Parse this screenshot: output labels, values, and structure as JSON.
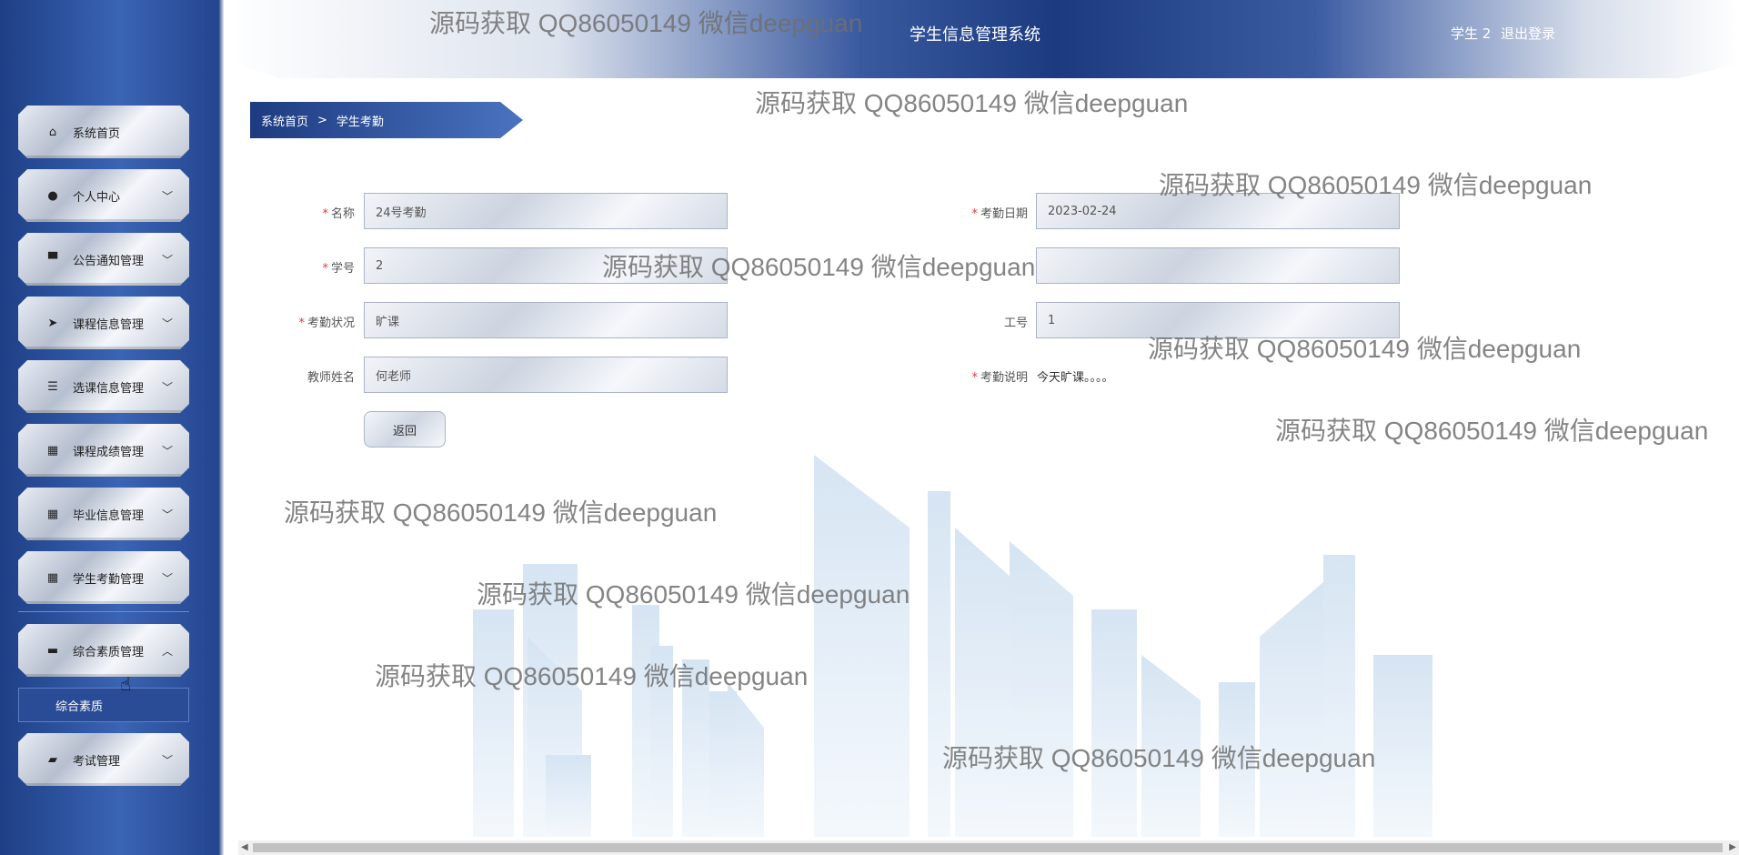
{
  "header": {
    "title": "学生信息管理系统",
    "user": "学生 2",
    "logout": "退出登录"
  },
  "breadcrumb": {
    "home": "系统首页",
    "sep": ">",
    "current": "学生考勤"
  },
  "sidebar": {
    "items": [
      {
        "label": "系统首页",
        "icon": "home-icon",
        "glyph": "⌂",
        "chevron": ""
      },
      {
        "label": "个人中心",
        "icon": "user-icon",
        "glyph": "●",
        "chevron": "﹀"
      },
      {
        "label": "公告通知管理",
        "icon": "notice-icon",
        "glyph": "▀",
        "chevron": "﹀"
      },
      {
        "label": "课程信息管理",
        "icon": "send-icon",
        "glyph": "➤",
        "chevron": "﹀"
      },
      {
        "label": "选课信息管理",
        "icon": "sliders-icon",
        "glyph": "☰",
        "chevron": "﹀"
      },
      {
        "label": "课程成绩管理",
        "icon": "grid-icon",
        "glyph": "▦",
        "chevron": "﹀"
      },
      {
        "label": "毕业信息管理",
        "icon": "grid-icon",
        "glyph": "▦",
        "chevron": "﹀"
      },
      {
        "label": "学生考勤管理",
        "icon": "grid-icon",
        "glyph": "▦",
        "chevron": "﹀"
      },
      {
        "label": "综合素质管理",
        "icon": "print-icon",
        "glyph": "▬",
        "chevron": "︿"
      },
      {
        "label": "考试管理",
        "icon": "briefcase-icon",
        "glyph": "▰",
        "chevron": "﹀"
      }
    ],
    "submenu": "综合素质"
  },
  "form": {
    "name_label": "名称",
    "name_value": "24号考勤",
    "date_label": "考勤日期",
    "date_value": "2023-02-24",
    "sid_label": "学号",
    "sid_value": "2",
    "status_label": "考勤状况",
    "status_value": "旷课",
    "tid_label": "工号",
    "tid_value": "1",
    "teacher_label": "教师姓名",
    "teacher_value": "何老师",
    "desc_label": "考勤说明",
    "desc_value": "今天旷课。。。。",
    "required_mark": "*",
    "back": "返回"
  },
  "watermark": "源码获取 QQ86050149 微信deepguan"
}
